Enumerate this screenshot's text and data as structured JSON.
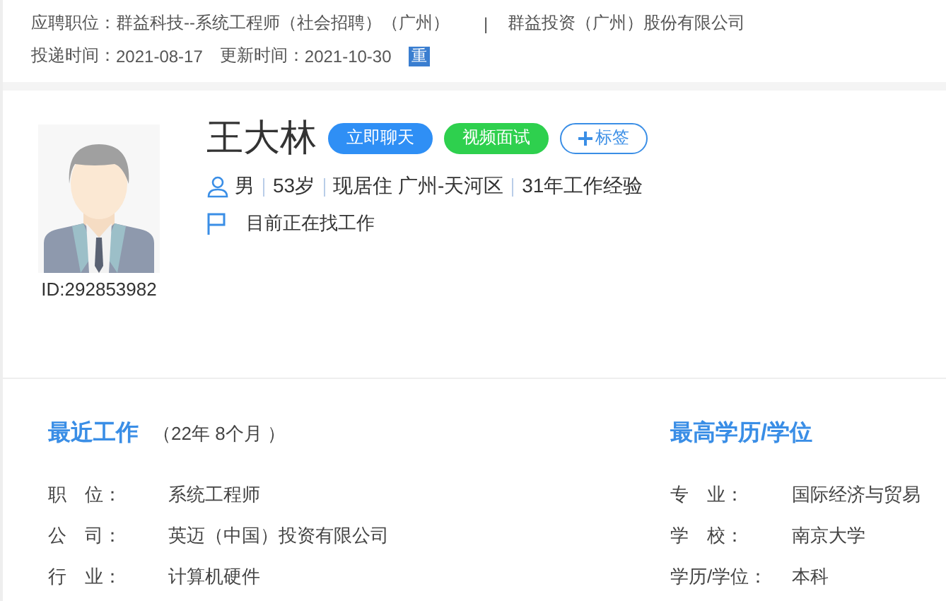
{
  "application": {
    "position_label": "应聘职位：",
    "position": "群益科技--系统工程师（社会招聘）（广州）",
    "separator": "|",
    "company": "群益投资（广州）股份有限公司",
    "delivered_label": "投递时间：",
    "delivered": "2021-08-17",
    "updated_label": "更新时间：",
    "updated": "2021-10-30",
    "badge": "重"
  },
  "profile": {
    "id": "ID:292853982",
    "name": "王大林",
    "buttons": [
      {
        "kind": "chat",
        "label": "立即聊天"
      },
      {
        "kind": "video",
        "label": "视频面试"
      },
      {
        "kind": "tag",
        "label": "标签"
      }
    ],
    "facts": [
      "男",
      "53岁",
      "现居住 广州-天河区",
      "31年工作经验"
    ],
    "status": "目前正在找工作"
  },
  "recent_work": {
    "title": "最近工作",
    "duration": "（22年 8个月 ）",
    "fields": [
      {
        "label": "职　位：",
        "value": "系统工程师"
      },
      {
        "label": "公　司：",
        "value": "英迈（中国）投资有限公司"
      },
      {
        "label": "行　业：",
        "value": "计算机硬件"
      }
    ]
  },
  "education": {
    "title": "最高学历/学位",
    "fields": [
      {
        "label": "专　业：",
        "value": "国际经济与贸易"
      },
      {
        "label": "学　校：",
        "value": "南京大学"
      },
      {
        "label": "学历/学位：",
        "value": "本科"
      }
    ]
  }
}
